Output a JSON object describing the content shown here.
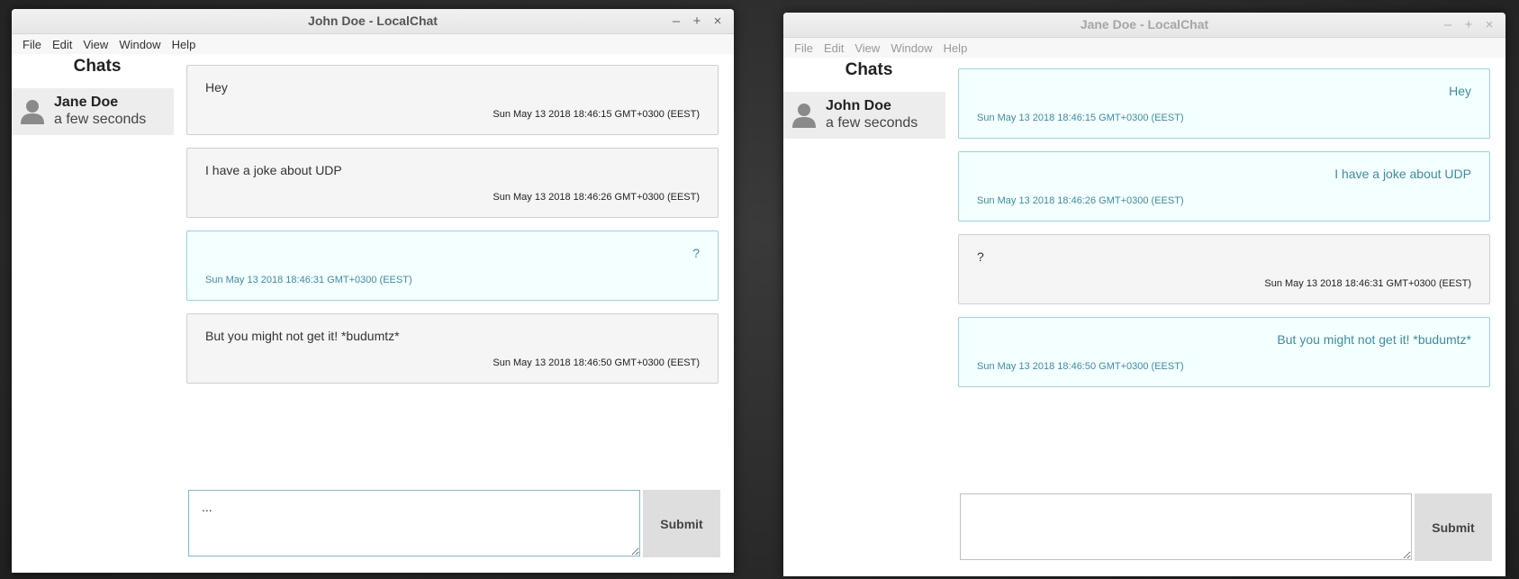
{
  "left_window": {
    "title": "John Doe - LocalChat",
    "controls": {
      "minimize": "–",
      "maximize": "+",
      "close": "×"
    },
    "menu": [
      "File",
      "Edit",
      "View",
      "Window",
      "Help"
    ],
    "sidebar": {
      "heading": "Chats",
      "chats": [
        {
          "name": "Jane Doe",
          "time": "a few seconds"
        }
      ]
    },
    "messages": [
      {
        "text": "Hey",
        "timestamp": "Sun May 13 2018 18:46:15 GMT+0300 (EEST)",
        "own": false
      },
      {
        "text": "I have a joke about UDP",
        "timestamp": "Sun May 13 2018 18:46:26 GMT+0300 (EEST)",
        "own": false
      },
      {
        "text": "?",
        "timestamp": "Sun May 13 2018 18:46:31 GMT+0300 (EEST)",
        "own": true
      },
      {
        "text": "But you might not get it! *budumtz*",
        "timestamp": "Sun May 13 2018 18:46:50 GMT+0300 (EEST)",
        "own": false
      }
    ],
    "composer": {
      "value": "...",
      "submit_label": "Submit"
    }
  },
  "right_window": {
    "title": "Jane Doe - LocalChat",
    "controls": {
      "minimize": "–",
      "maximize": "+",
      "close": "×"
    },
    "menu": [
      "File",
      "Edit",
      "View",
      "Window",
      "Help"
    ],
    "sidebar": {
      "heading": "Chats",
      "chats": [
        {
          "name": "John Doe",
          "time": "a few seconds"
        }
      ]
    },
    "messages": [
      {
        "text": "Hey",
        "timestamp": "Sun May 13 2018 18:46:15 GMT+0300 (EEST)",
        "own": true
      },
      {
        "text": "I have a joke about UDP",
        "timestamp": "Sun May 13 2018 18:46:26 GMT+0300 (EEST)",
        "own": true
      },
      {
        "text": "?",
        "timestamp": "Sun May 13 2018 18:46:31 GMT+0300 (EEST)",
        "own": false
      },
      {
        "text": "But you might not get it! *budumtz*",
        "timestamp": "Sun May 13 2018 18:46:50 GMT+0300 (EEST)",
        "own": true
      }
    ],
    "composer": {
      "value": "",
      "submit_label": "Submit"
    }
  },
  "icons": {
    "avatar": "person-avatar-icon"
  },
  "colors": {
    "own_message_bg": "#f4ffff",
    "own_message_border": "#99d3e5",
    "own_message_text": "#3c8ca4",
    "other_message_bg": "#f5f5f5"
  }
}
